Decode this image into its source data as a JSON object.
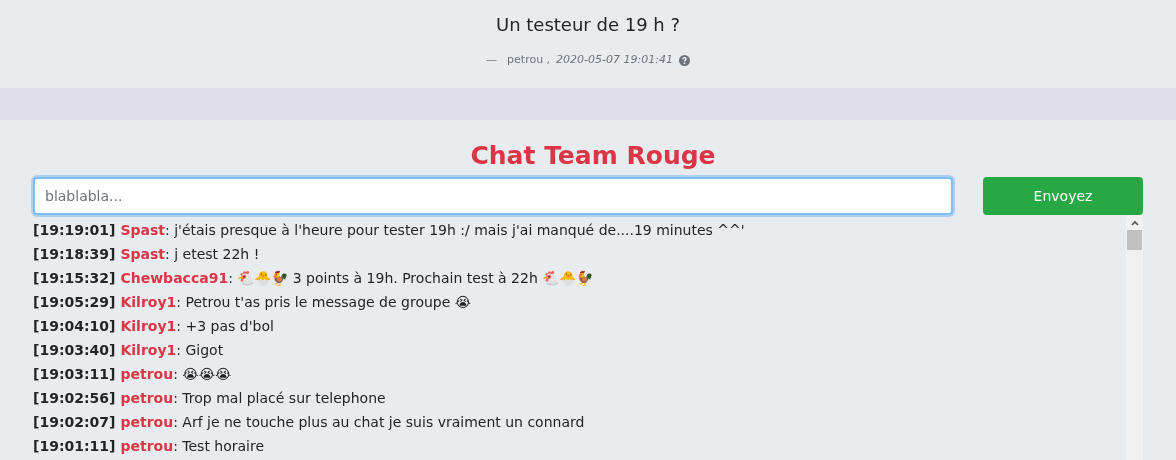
{
  "post": {
    "title": "Un testeur de 19 h ?",
    "dash": "—",
    "author": "petrou ,",
    "date": "2020-05-07 19:01:41"
  },
  "chat": {
    "title": "Chat Team Rouge",
    "input": {
      "placeholder": "blablabla..."
    },
    "send_button": "Envoyez",
    "messages": [
      {
        "time": "[19:19:01]",
        "user": "Spast",
        "text": ": j'étais presque à l'heure pour tester 19h :/ mais j'ai manqué de....19 minutes ^^'"
      },
      {
        "time": "[19:18:39]",
        "user": "Spast",
        "text": ": j etest 22h !"
      },
      {
        "time": "[19:15:32]",
        "user": "Chewbacca91",
        "text": ": 🐔🐣🐓 3 points à 19h. Prochain test à 22h 🐔🐣🐓"
      },
      {
        "time": "[19:05:29]",
        "user": "Kilroy1",
        "text": ": Petrou t'as pris le message de groupe 😭"
      },
      {
        "time": "[19:04:10]",
        "user": "Kilroy1",
        "text": ": +3 pas d'bol"
      },
      {
        "time": "[19:03:40]",
        "user": "Kilroy1",
        "text": ": Gigot"
      },
      {
        "time": "[19:03:11]",
        "user": "petrou",
        "text": ": 😭😭😭"
      },
      {
        "time": "[19:02:56]",
        "user": "petrou",
        "text": ": Trop mal placé sur telephone"
      },
      {
        "time": "[19:02:07]",
        "user": "petrou",
        "text": ": Arf je ne touche plus au chat je suis vraiment un connard"
      },
      {
        "time": "[19:01:11]",
        "user": "petrou",
        "text": ": Test horaire"
      }
    ]
  }
}
